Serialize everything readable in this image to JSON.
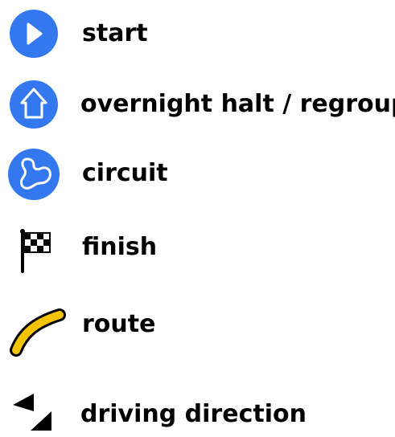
{
  "legend": {
    "items": [
      {
        "icon": "start-icon",
        "label": "start"
      },
      {
        "icon": "overnight-halt-icon",
        "label": "overnight halt / regroup"
      },
      {
        "icon": "circuit-icon",
        "label": "circuit"
      },
      {
        "icon": "finish-flag-icon",
        "label": "finish"
      },
      {
        "icon": "route-icon",
        "label": "route"
      },
      {
        "icon": "driving-direction-icon",
        "label": "driving direction"
      }
    ]
  },
  "colors": {
    "marker_blue": "#3478f0",
    "route_yellow": "#f5c400",
    "text": "#000000"
  }
}
